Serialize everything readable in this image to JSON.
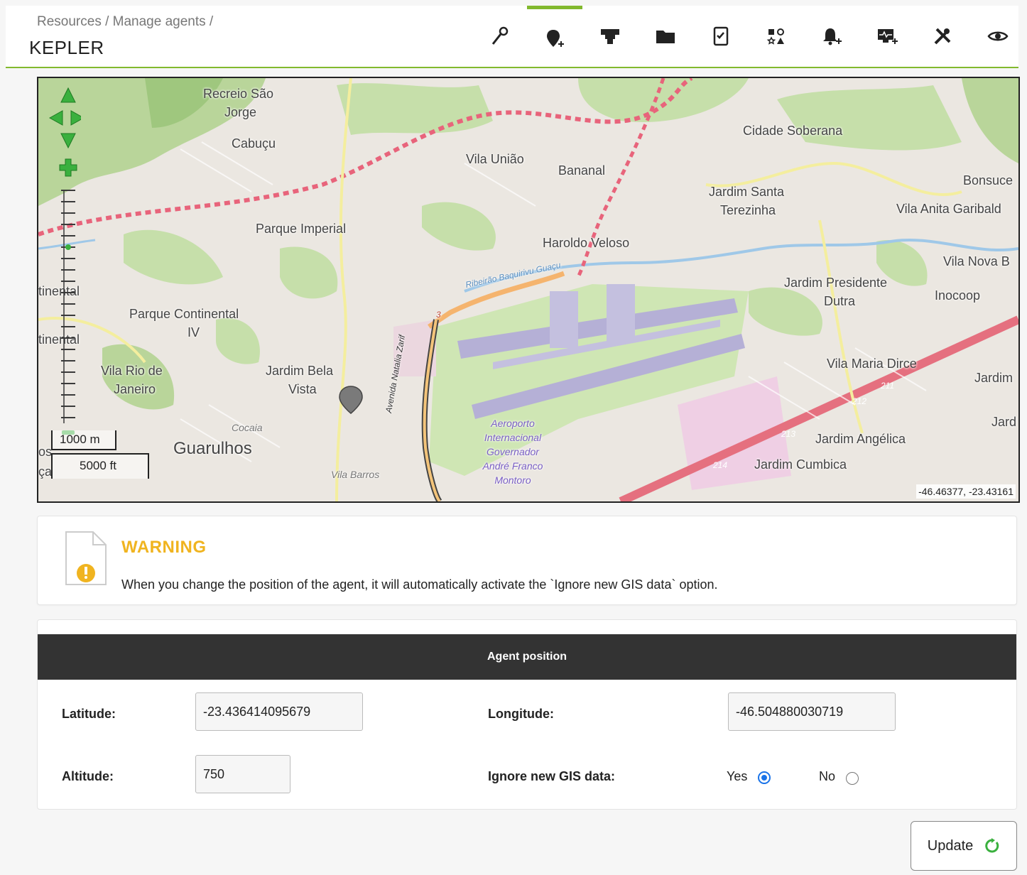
{
  "header": {
    "breadcrumb": "Resources / Manage agents /",
    "title": "KEPLER",
    "accent_color": "#82b92e",
    "tabs": [
      {
        "icon": "wrench-key-icon",
        "active": false
      },
      {
        "icon": "map-pin-plus-icon",
        "active": true
      },
      {
        "icon": "network-icon",
        "active": false
      },
      {
        "icon": "folder-icon",
        "active": false
      },
      {
        "icon": "checklist-icon",
        "active": false
      },
      {
        "icon": "shapes-icon",
        "active": false
      },
      {
        "icon": "bell-plus-icon",
        "active": false
      },
      {
        "icon": "monitor-plus-icon",
        "active": false
      },
      {
        "icon": "tools-icon",
        "active": false
      },
      {
        "icon": "eye-icon",
        "active": false
      }
    ]
  },
  "map": {
    "places": {
      "recreio": "Recreio São",
      "recreio2": "Jorge",
      "cabucu": "Cabuçu",
      "vila_uniao": "Vila União",
      "bananal": "Bananal",
      "cidade_soberana": "Cidade Soberana",
      "bonsuce": "Bonsuce",
      "jardim_santa": "Jardim Santa",
      "terezinha": "Terezinha",
      "vila_anita": "Vila Anita Garibald",
      "parque_imperial": "Parque Imperial",
      "haroldo": "Haroldo Veloso",
      "vila_nova": "Vila Nova B",
      "ribeirao": "Ribeirão Baquirivu Guaçu",
      "jardim_presidente": "Jardim Presidente",
      "dutra": "Dutra",
      "inocoop": "Inocoop",
      "continental1": "tinental",
      "parque_continental": "Parque Continental",
      "iv": "IV",
      "continental2": "tinental",
      "vila_maria": "Vila Maria Dirce",
      "jardim_r": "Jardim",
      "vila_rio": "Vila Rio de",
      "janeiro": "Janeiro",
      "jardim_bela": "Jardim Bela",
      "vista": "Vista",
      "cocaia": "Cocaia",
      "guarulhos": "Guarulhos",
      "aeroporto": "Aeroporto",
      "internacional": "Internacional",
      "governador": "Governador",
      "andre": "André Franco",
      "montoro": "Montoro",
      "jardim_angelica": "Jardim Angélica",
      "jard_r": "Jard",
      "jardim_cumbica": "Jardim Cumbica",
      "vila_barros": "Vila Barros",
      "avenida": "Avenida Natalia Zarif",
      "road3": "3",
      "km211": "211",
      "km212": "212",
      "km213": "213",
      "km214": "214",
      "os": "os",
      "ca": "ça"
    },
    "scale_m": "1000 m",
    "scale_ft": "5000 ft",
    "coordinates": "-46.46377, -23.43161"
  },
  "warning": {
    "title": "WARNING",
    "text": "When you change the position of the agent, it will automatically activate the `Ignore new GIS data` option.",
    "color": "#f0b420"
  },
  "position": {
    "heading": "Agent position",
    "latitude_label": "Latitude:",
    "latitude_value": "-23.436414095679",
    "longitude_label": "Longitude:",
    "longitude_value": "-46.504880030719",
    "altitude_label": "Altitude:",
    "altitude_value": "750",
    "ignore_label": "Ignore new GIS data:",
    "yes_label": "Yes",
    "no_label": "No",
    "ignore_selected": "Yes"
  },
  "update_button": {
    "label": "Update"
  }
}
